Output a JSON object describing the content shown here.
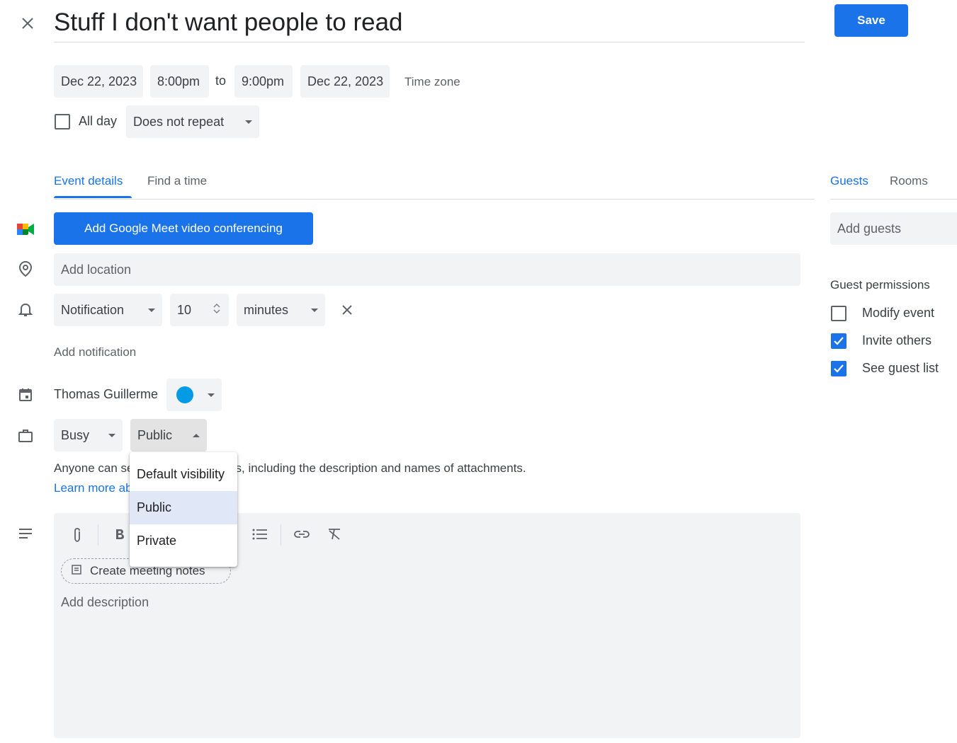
{
  "header": {
    "title": "Stuff I don't want people to read",
    "save_label": "Save"
  },
  "datetime": {
    "start_date": "Dec 22, 2023",
    "start_time": "8:00pm",
    "to_label": "to",
    "end_time": "9:00pm",
    "end_date": "Dec 22, 2023",
    "timezone_label": "Time zone",
    "all_day_label": "All day",
    "all_day_checked": false,
    "repeat_value": "Does not repeat"
  },
  "tabs": {
    "left": [
      {
        "label": "Event details",
        "active": true
      },
      {
        "label": "Find a time",
        "active": false
      }
    ],
    "right": [
      {
        "label": "Guests",
        "active": true
      },
      {
        "label": "Rooms",
        "active": false
      }
    ]
  },
  "details": {
    "meet_button": "Add Google Meet video conferencing",
    "location_placeholder": "Add location",
    "notification_type": "Notification",
    "notification_value": "10",
    "notification_unit": "minutes",
    "add_notification": "Add notification",
    "calendar_owner": "Thomas Guillerme",
    "calendar_color": "#039be5",
    "availability": "Busy",
    "visibility": "Public",
    "visibility_note": "Anyone can see this event's details, including the description and names of attachments.",
    "learn_more": "Learn more about visibility",
    "create_notes": "Create meeting notes",
    "description_placeholder": "Add description"
  },
  "visibility_menu": {
    "options": [
      "Default visibility",
      "Public",
      "Private"
    ],
    "selected": "Public"
  },
  "guests": {
    "add_placeholder": "Add guests",
    "permissions_title": "Guest permissions",
    "permissions": [
      {
        "label": "Modify event",
        "checked": false
      },
      {
        "label": "Invite others",
        "checked": true
      },
      {
        "label": "See guest list",
        "checked": true
      }
    ]
  },
  "colors": {
    "accent": "#1a73e8",
    "field_bg": "#f1f3f4",
    "text": "#3c4043"
  },
  "icons": {
    "close": "close-icon",
    "meet": "google-meet-icon",
    "location": "location-pin-icon",
    "notification": "bell-icon",
    "calendar": "calendar-icon",
    "status": "briefcase-icon",
    "description": "text-lines-icon"
  }
}
